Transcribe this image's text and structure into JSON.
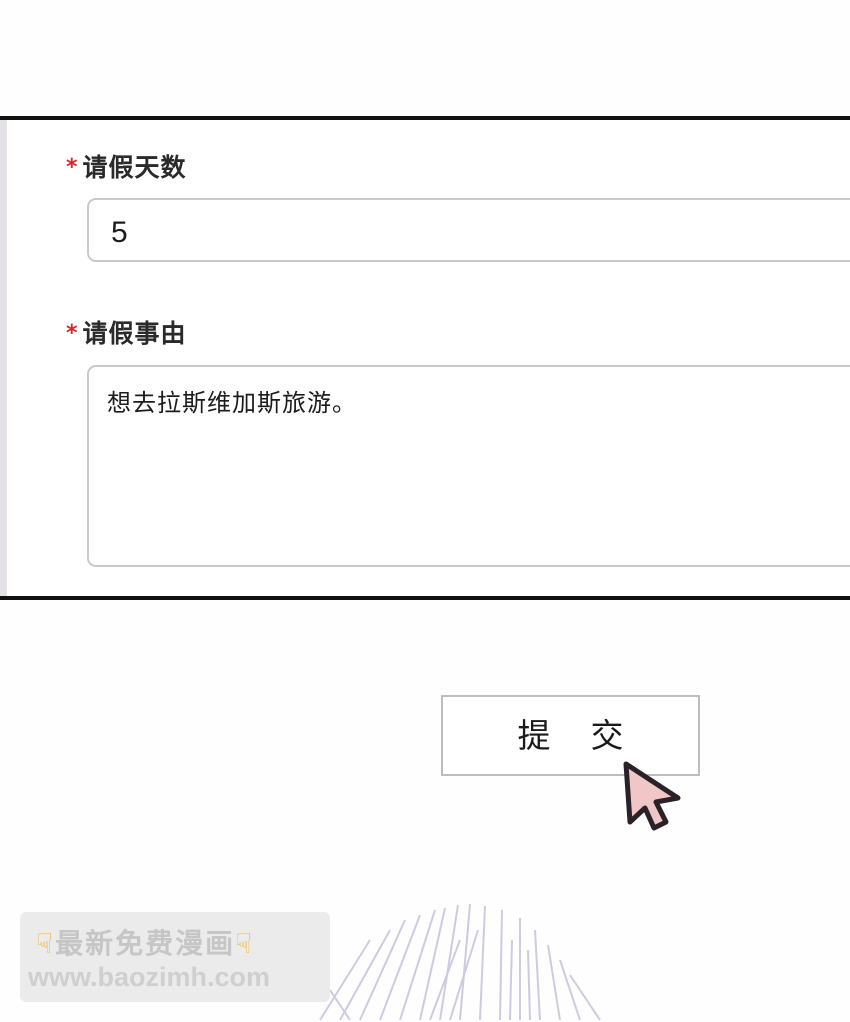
{
  "form": {
    "required_mark": "*",
    "days_label": "请假天数",
    "days_value": "5",
    "reason_label": "请假事由",
    "reason_value": "想去拉斯维加斯旅游。"
  },
  "submit": {
    "label": "提交"
  },
  "watermark": {
    "line1": "最新免费漫画",
    "line2": "www.baozimh.com"
  },
  "colors": {
    "required": "#d8242b",
    "border": "#c9c9c9",
    "cursor_fill": "#f1c6c6"
  },
  "icons": {
    "cursor": "mouse-pointer-icon",
    "finger": "pointing-down-hand-icon"
  }
}
